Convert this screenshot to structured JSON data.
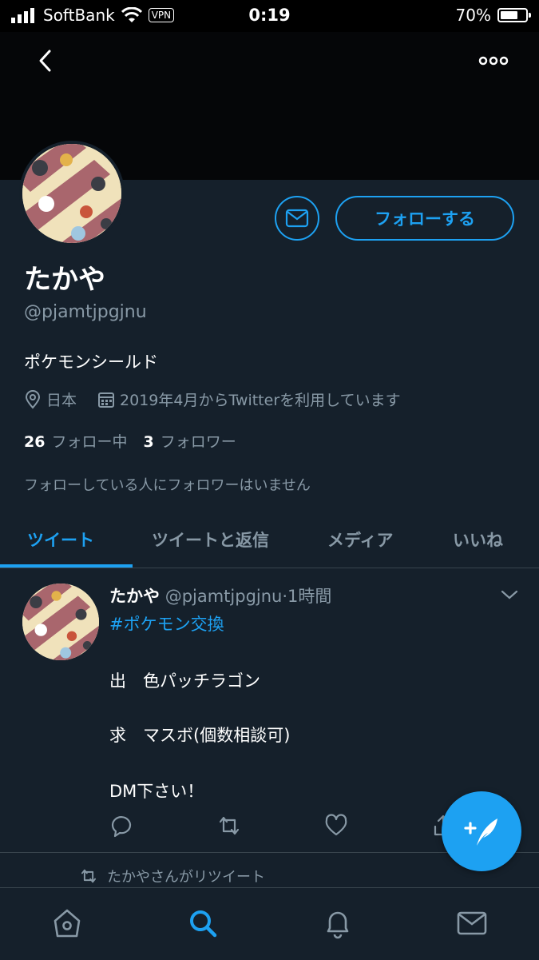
{
  "status_bar": {
    "carrier": "SoftBank",
    "vpn": "VPN",
    "time": "0:19",
    "battery_percent": "70%",
    "battery_level": 0.7
  },
  "profile": {
    "display_name": "たかや",
    "handle": "@pjamtjpgjnu",
    "bio": "ポケモンシールド",
    "location": "日本",
    "joined": "2019年4月からTwitterを利用しています",
    "following_count": "26",
    "following_label": "フォロー中",
    "followers_count": "3",
    "followers_label": "フォロワー",
    "followed_by_note": "フォローしている人にフォロワーはいません",
    "follow_button_label": "フォローする"
  },
  "tabs": [
    {
      "label": "ツイート",
      "active": true
    },
    {
      "label": "ツイートと返信",
      "active": false
    },
    {
      "label": "メディア",
      "active": false
    },
    {
      "label": "いいね",
      "active": false
    }
  ],
  "tweet": {
    "author_name": "たかや",
    "author_handle": "@pjamtjpgjnu",
    "time": "·1時間",
    "hashtag": "#ポケモン交換",
    "line1": "出　色パッチラゴン",
    "line2": "求　マスボ(個数相談可)",
    "line3": "DM下さい！"
  },
  "retweet_note": "たかやさんがリツイート",
  "icons": {
    "back": "back-chevron-icon",
    "more": "more-dots-icon",
    "dm": "envelope-icon",
    "location": "location-pin-icon",
    "calendar": "calendar-icon",
    "reply": "reply-icon",
    "retweet": "retweet-icon",
    "like": "heart-icon",
    "share": "share-icon",
    "compose": "compose-feather-icon",
    "home": "home-icon",
    "search": "search-icon",
    "notifications": "bell-icon",
    "messages": "mail-icon"
  },
  "colors": {
    "background": "#15202b",
    "accent": "#1da1f2",
    "secondary_text": "#8899a6",
    "divider": "#38444d"
  }
}
